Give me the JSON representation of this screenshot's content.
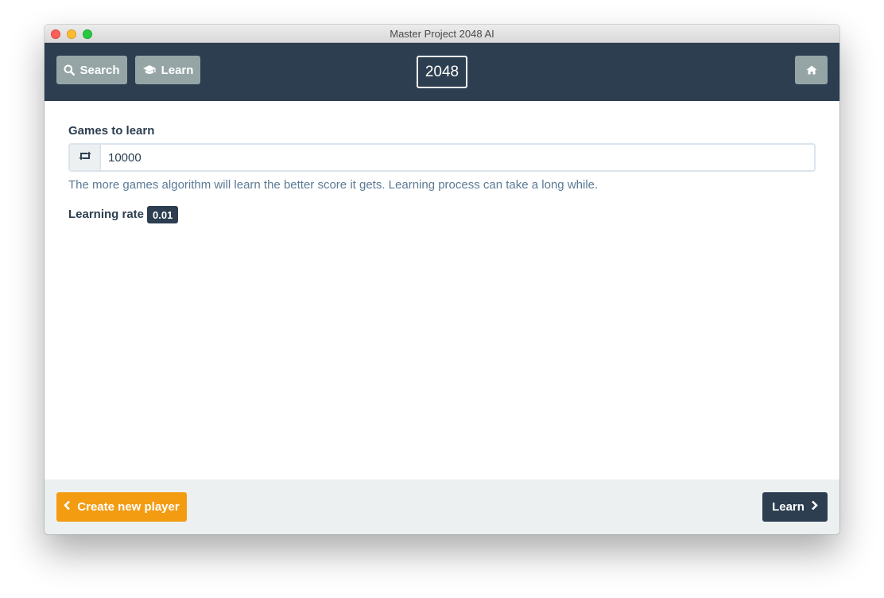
{
  "window": {
    "title": "Master Project 2048 AI"
  },
  "navbar": {
    "search_label": "Search",
    "learn_label": "Learn",
    "brand": "2048",
    "icons": {
      "search": "search-icon",
      "learn": "graduation-cap-icon",
      "home": "home-icon"
    }
  },
  "form": {
    "games_label": "Games to learn",
    "games_value": "10000",
    "games_icon": "retweet-icon",
    "help_text": "The more games algorithm will learn the better score it gets. Learning process can take a long while.",
    "rate_label": "Learning rate",
    "rate_value": "0.01"
  },
  "footer": {
    "back_label": "Create new player",
    "next_label": "Learn",
    "icons": {
      "back": "chevron-left-icon",
      "next": "chevron-right-icon"
    }
  },
  "colors": {
    "primary": "#2c3e50",
    "secondary": "#95a5a6",
    "warning": "#f39c12",
    "footer_bg": "#ecf0f1",
    "help_text": "#5b7a96"
  }
}
